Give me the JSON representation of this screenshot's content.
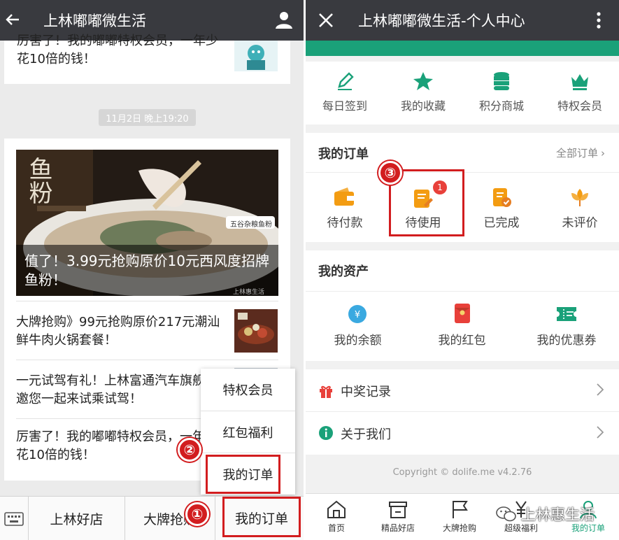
{
  "left": {
    "title": "上林嘟嘟微生活",
    "top_partial_text": "厉害了！我的嘟嘟特权会员，一年少花10倍的钱！",
    "timestamp": "11月2日 晚上19:20",
    "hero_caption": "值了！3.99元抢购原价10元西风度招牌鱼粉！",
    "hero_overlay_text": "鱼粉",
    "hero_sign": "五谷杂粮鱼粉",
    "hero_watermark": "上林惠生活",
    "articles": [
      {
        "text": "大牌抢购》99元抢购原价217元潮汕鲜牛肉火锅套餐！"
      },
      {
        "text": "一元试驾有礼！上林富通汽车旗舰店邀您一起来试乘试驾！"
      },
      {
        "text": "厉害了！我的嘟嘟特权会员，一年少花10倍的钱！"
      }
    ],
    "popup_menu": [
      "特权会员",
      "红包福利",
      "我的订单"
    ],
    "bottom_menu": [
      "上林好店",
      "大牌抢购",
      "我的订单"
    ],
    "badges": {
      "one": "①",
      "two": "②"
    }
  },
  "right": {
    "title": "上林嘟嘟微生活-个人中心",
    "quick_actions": [
      {
        "label": "每日签到",
        "icon": "pencil-icon"
      },
      {
        "label": "我的收藏",
        "icon": "star-icon"
      },
      {
        "label": "积分商城",
        "icon": "coins-icon"
      },
      {
        "label": "特权会员",
        "icon": "crown-icon"
      }
    ],
    "orders": {
      "title": "我的订单",
      "all_link": "全部订单",
      "items": [
        {
          "label": "待付款",
          "icon": "wallet-icon"
        },
        {
          "label": "待使用",
          "icon": "ticket-edit-icon",
          "badge": "1"
        },
        {
          "label": "已完成",
          "icon": "check-doc-icon"
        },
        {
          "label": "未评价",
          "icon": "flower-icon"
        }
      ],
      "step_badge": "③"
    },
    "assets": {
      "title": "我的资产",
      "items": [
        {
          "label": "我的余额",
          "icon": "yen-coin-icon"
        },
        {
          "label": "我的红包",
          "icon": "red-envelope-icon"
        },
        {
          "label": "我的优惠券",
          "icon": "coupon-icon"
        }
      ]
    },
    "list": [
      {
        "label": "中奖记录",
        "icon": "gift-icon"
      },
      {
        "label": "关于我们",
        "icon": "info-icon"
      }
    ],
    "copyright": "Copyright © dolife.me v4.2.76",
    "tabs": [
      {
        "label": "首页",
        "icon": "home-icon",
        "active": false
      },
      {
        "label": "精品好店",
        "icon": "shop-icon",
        "active": false
      },
      {
        "label": "大牌抢购",
        "icon": "flag-icon",
        "active": false
      },
      {
        "label": "超级福利",
        "icon": "yen-icon",
        "active": false
      },
      {
        "label": "我的订单",
        "icon": "user-icon",
        "active": true
      }
    ],
    "watermark": "上林惠生活"
  },
  "colors": {
    "accent": "#1aa179",
    "titlebar": "#393a3f",
    "highlight": "#d21d1f",
    "orange": "#f39c12",
    "red": "#e8403a"
  }
}
